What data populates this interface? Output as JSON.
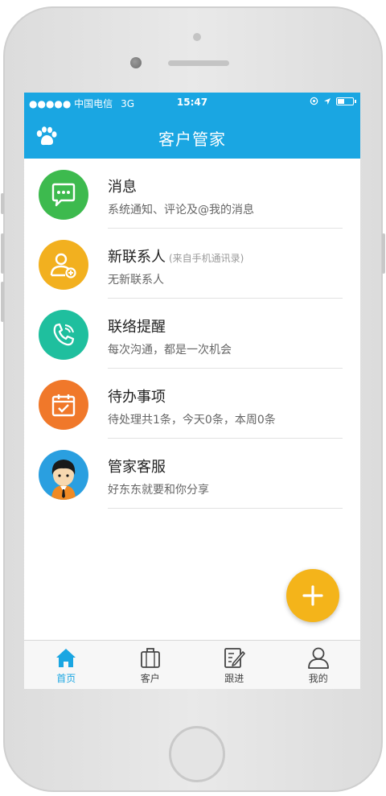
{
  "status": {
    "carrier": "●●●●● 中国电信",
    "network": "3G",
    "time": "15:47"
  },
  "nav": {
    "title": "客户管家"
  },
  "items": [
    {
      "title": "消息",
      "note": "",
      "subtitle": "系统通知、评论及@我的消息",
      "icon": "chat-bubble-icon",
      "color": "#3dba4e"
    },
    {
      "title": "新联系人",
      "note": "(来自手机通讯录)",
      "subtitle": "无新联系人",
      "icon": "add-contact-icon",
      "color": "#f2b01f"
    },
    {
      "title": "联络提醒",
      "note": "",
      "subtitle": "每次沟通，都是一次机会",
      "icon": "phone-icon",
      "color": "#1fbf9e"
    },
    {
      "title": "待办事项",
      "note": "",
      "subtitle": "待处理共1条，今天0条，本周0条",
      "icon": "calendar-check-icon",
      "color": "#f0782a"
    },
    {
      "title": "管家客服",
      "note": "",
      "subtitle": "好东东就要和你分享",
      "icon": "service-agent-avatar",
      "color": "#2a9fe0"
    }
  ],
  "tabs": [
    {
      "label": "首页",
      "icon": "home-icon",
      "active": true
    },
    {
      "label": "客户",
      "icon": "briefcase-icon",
      "active": false
    },
    {
      "label": "跟进",
      "icon": "edit-note-icon",
      "active": false
    },
    {
      "label": "我的",
      "icon": "user-icon",
      "active": false
    }
  ],
  "colors": {
    "accent": "#1aa6e2",
    "fab": "#f4b41a"
  }
}
